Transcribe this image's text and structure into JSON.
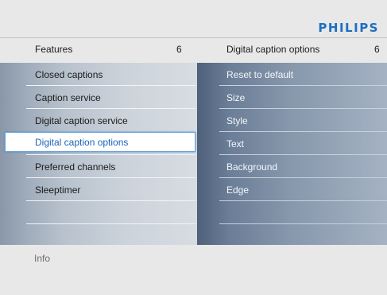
{
  "brand": {
    "logo": "PHILIPS",
    "color": "#1e6fc0"
  },
  "left_panel": {
    "title": "Features",
    "count": "6",
    "items": [
      {
        "label": "Closed captions"
      },
      {
        "label": "Caption service"
      },
      {
        "label": "Digital caption service"
      },
      {
        "label": "Digital caption options",
        "selected": true
      },
      {
        "label": "Preferred channels"
      },
      {
        "label": "Sleeptimer"
      },
      {
        "label": ""
      },
      {
        "label": ""
      }
    ]
  },
  "right_panel": {
    "title": "Digital caption options",
    "count": "6",
    "items": [
      {
        "label": "Reset to default"
      },
      {
        "label": "Size"
      },
      {
        "label": "Style"
      },
      {
        "label": "Text"
      },
      {
        "label": "Background"
      },
      {
        "label": "Edge"
      },
      {
        "label": ""
      },
      {
        "label": ""
      }
    ]
  },
  "footer": {
    "info_label": "Info"
  }
}
